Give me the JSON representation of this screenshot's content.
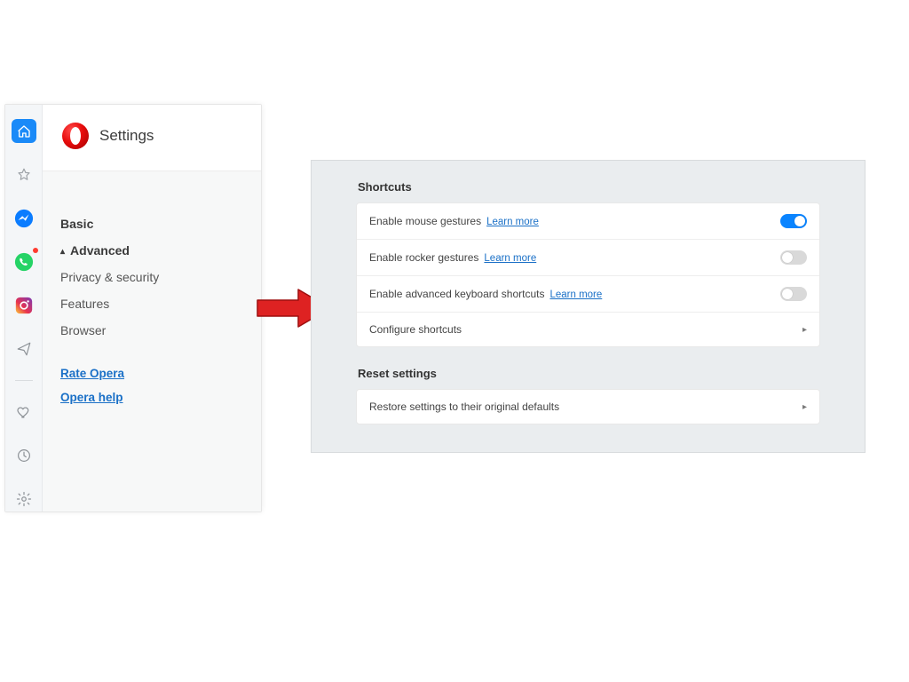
{
  "header": {
    "title": "Settings"
  },
  "rail_icons": {
    "home": "home-icon",
    "star": "star-icon",
    "messenger": "messenger-icon",
    "whatsapp": "whatsapp-icon",
    "instagram": "instagram-icon",
    "send": "send-icon",
    "heart": "heart-icon",
    "clock": "clock-icon",
    "gear": "gear-icon"
  },
  "nav": {
    "basic": "Basic",
    "advanced": "Advanced",
    "privacy": "Privacy & security",
    "features": "Features",
    "browser": "Browser",
    "rate": "Rate Opera",
    "help": "Opera help"
  },
  "shortcuts": {
    "heading": "Shortcuts",
    "rows": [
      {
        "label": "Enable mouse gestures",
        "link": "Learn more",
        "enabled": true
      },
      {
        "label": "Enable rocker gestures",
        "link": "Learn more",
        "enabled": false
      },
      {
        "label": "Enable advanced keyboard shortcuts",
        "link": "Learn more",
        "enabled": false
      }
    ],
    "configure": "Configure shortcuts"
  },
  "reset": {
    "heading": "Reset settings",
    "restore": "Restore settings to their original defaults"
  },
  "colors": {
    "toggle_on": "#0a84ff",
    "arrow": "#de2222"
  }
}
